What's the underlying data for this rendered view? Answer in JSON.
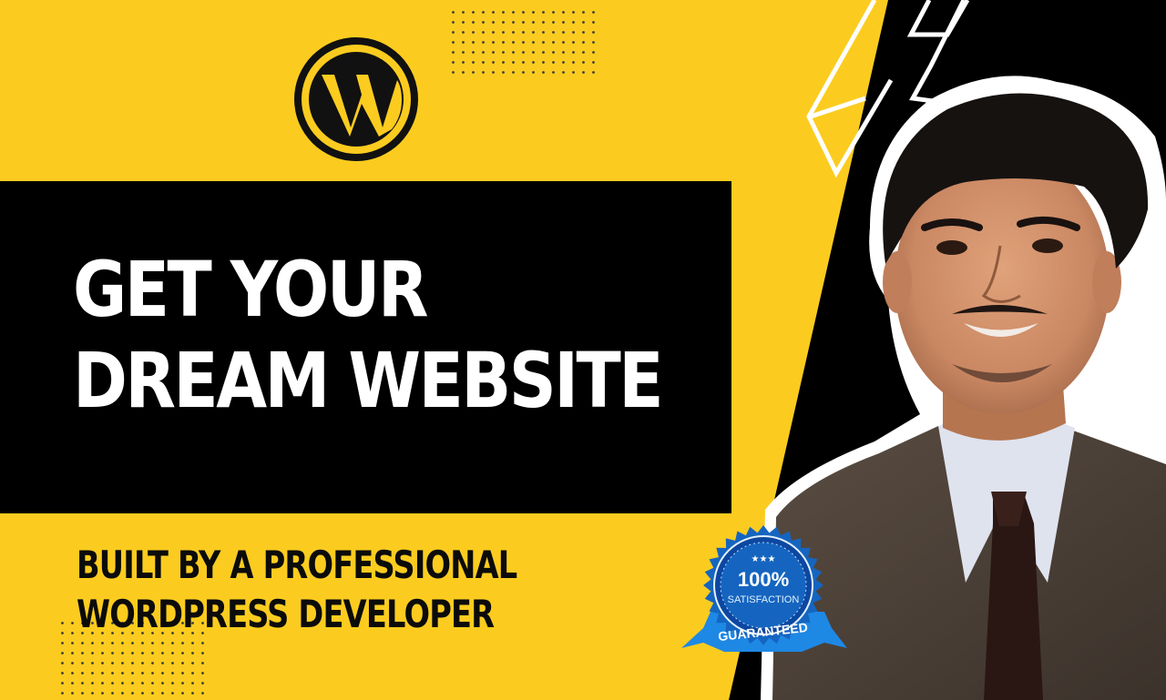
{
  "headline": {
    "line1": "GET YOUR",
    "line2": "DREAM WEBSITE"
  },
  "subheadline": {
    "line1": "BUILT BY A PROFESSIONAL",
    "line2": "WORDPRESS DEVELOPER"
  },
  "badge": {
    "stars": "★★★",
    "percent": "100%",
    "satisfaction": "SATISFACTION",
    "ribbon": "GUARANTEED"
  },
  "colors": {
    "yellow": "#fbcc1f",
    "black": "#000000",
    "badge_blue": "#1565c0",
    "ribbon_blue": "#1e88e5"
  },
  "icons": {
    "logo": "wordpress-logo-icon",
    "badge": "satisfaction-guaranteed-badge-icon"
  }
}
